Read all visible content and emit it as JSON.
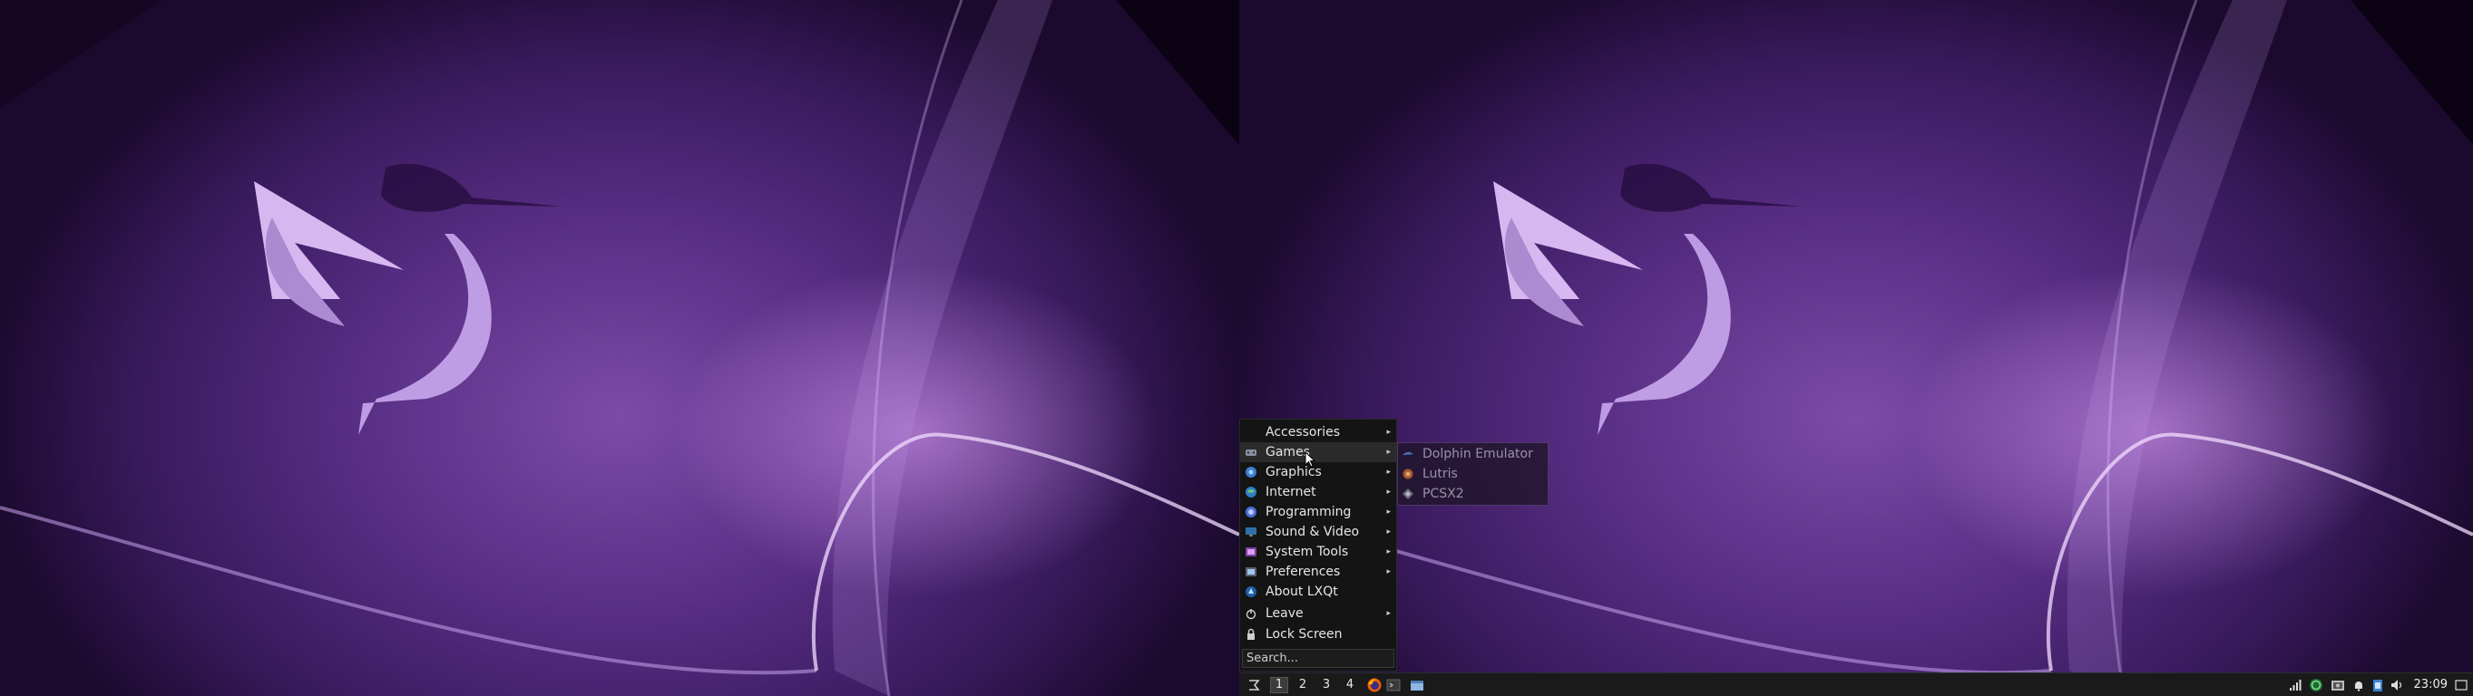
{
  "start_menu": {
    "items": [
      {
        "label": "Accessories",
        "icon": "accessories-icon",
        "submenu": true
      },
      {
        "label": "Games",
        "icon": "games-icon",
        "submenu": true
      },
      {
        "label": "Graphics",
        "icon": "graphics-icon",
        "submenu": true
      },
      {
        "label": "Internet",
        "icon": "internet-icon",
        "submenu": true
      },
      {
        "label": "Programming",
        "icon": "programming-icon",
        "submenu": true
      },
      {
        "label": "Sound & Video",
        "icon": "sound-video-icon",
        "submenu": true
      },
      {
        "label": "System Tools",
        "icon": "system-tools-icon",
        "submenu": true
      },
      {
        "label": "Preferences",
        "icon": "preferences-icon",
        "submenu": true
      },
      {
        "label": "About LXQt",
        "icon": "lxqt-icon",
        "submenu": false
      },
      {
        "label": "Leave",
        "icon": "power-icon",
        "submenu": true
      },
      {
        "label": "Lock Screen",
        "icon": "lock-icon",
        "submenu": false
      }
    ],
    "search_placeholder": "Search...",
    "arrow": "▸",
    "hovered_item": "Games"
  },
  "games_submenu": {
    "items": [
      {
        "label": "Dolphin Emulator",
        "icon": "dolphin-icon"
      },
      {
        "label": "Lutris",
        "icon": "lutris-icon"
      },
      {
        "label": "PCSX2",
        "icon": "pcsx2-icon"
      }
    ]
  },
  "taskbar": {
    "workspaces": [
      "1",
      "2",
      "3",
      "4"
    ],
    "active_workspace": "1",
    "launchers": [
      "firefox-icon",
      "terminal-icon",
      "file-manager-icon"
    ],
    "tray_icons": [
      "network-signal-icon",
      "update-notifier-icon",
      "screenshot-icon",
      "notifications-icon",
      "clipboard-icon",
      "volume-icon"
    ],
    "clock": "23:09",
    "show_desktop_icon": "show-desktop-icon"
  },
  "colors": {
    "wallpaper_purple": "#5a2f86",
    "taskbar_bg": "#1a1a1a",
    "menu_bg": "#141414"
  }
}
